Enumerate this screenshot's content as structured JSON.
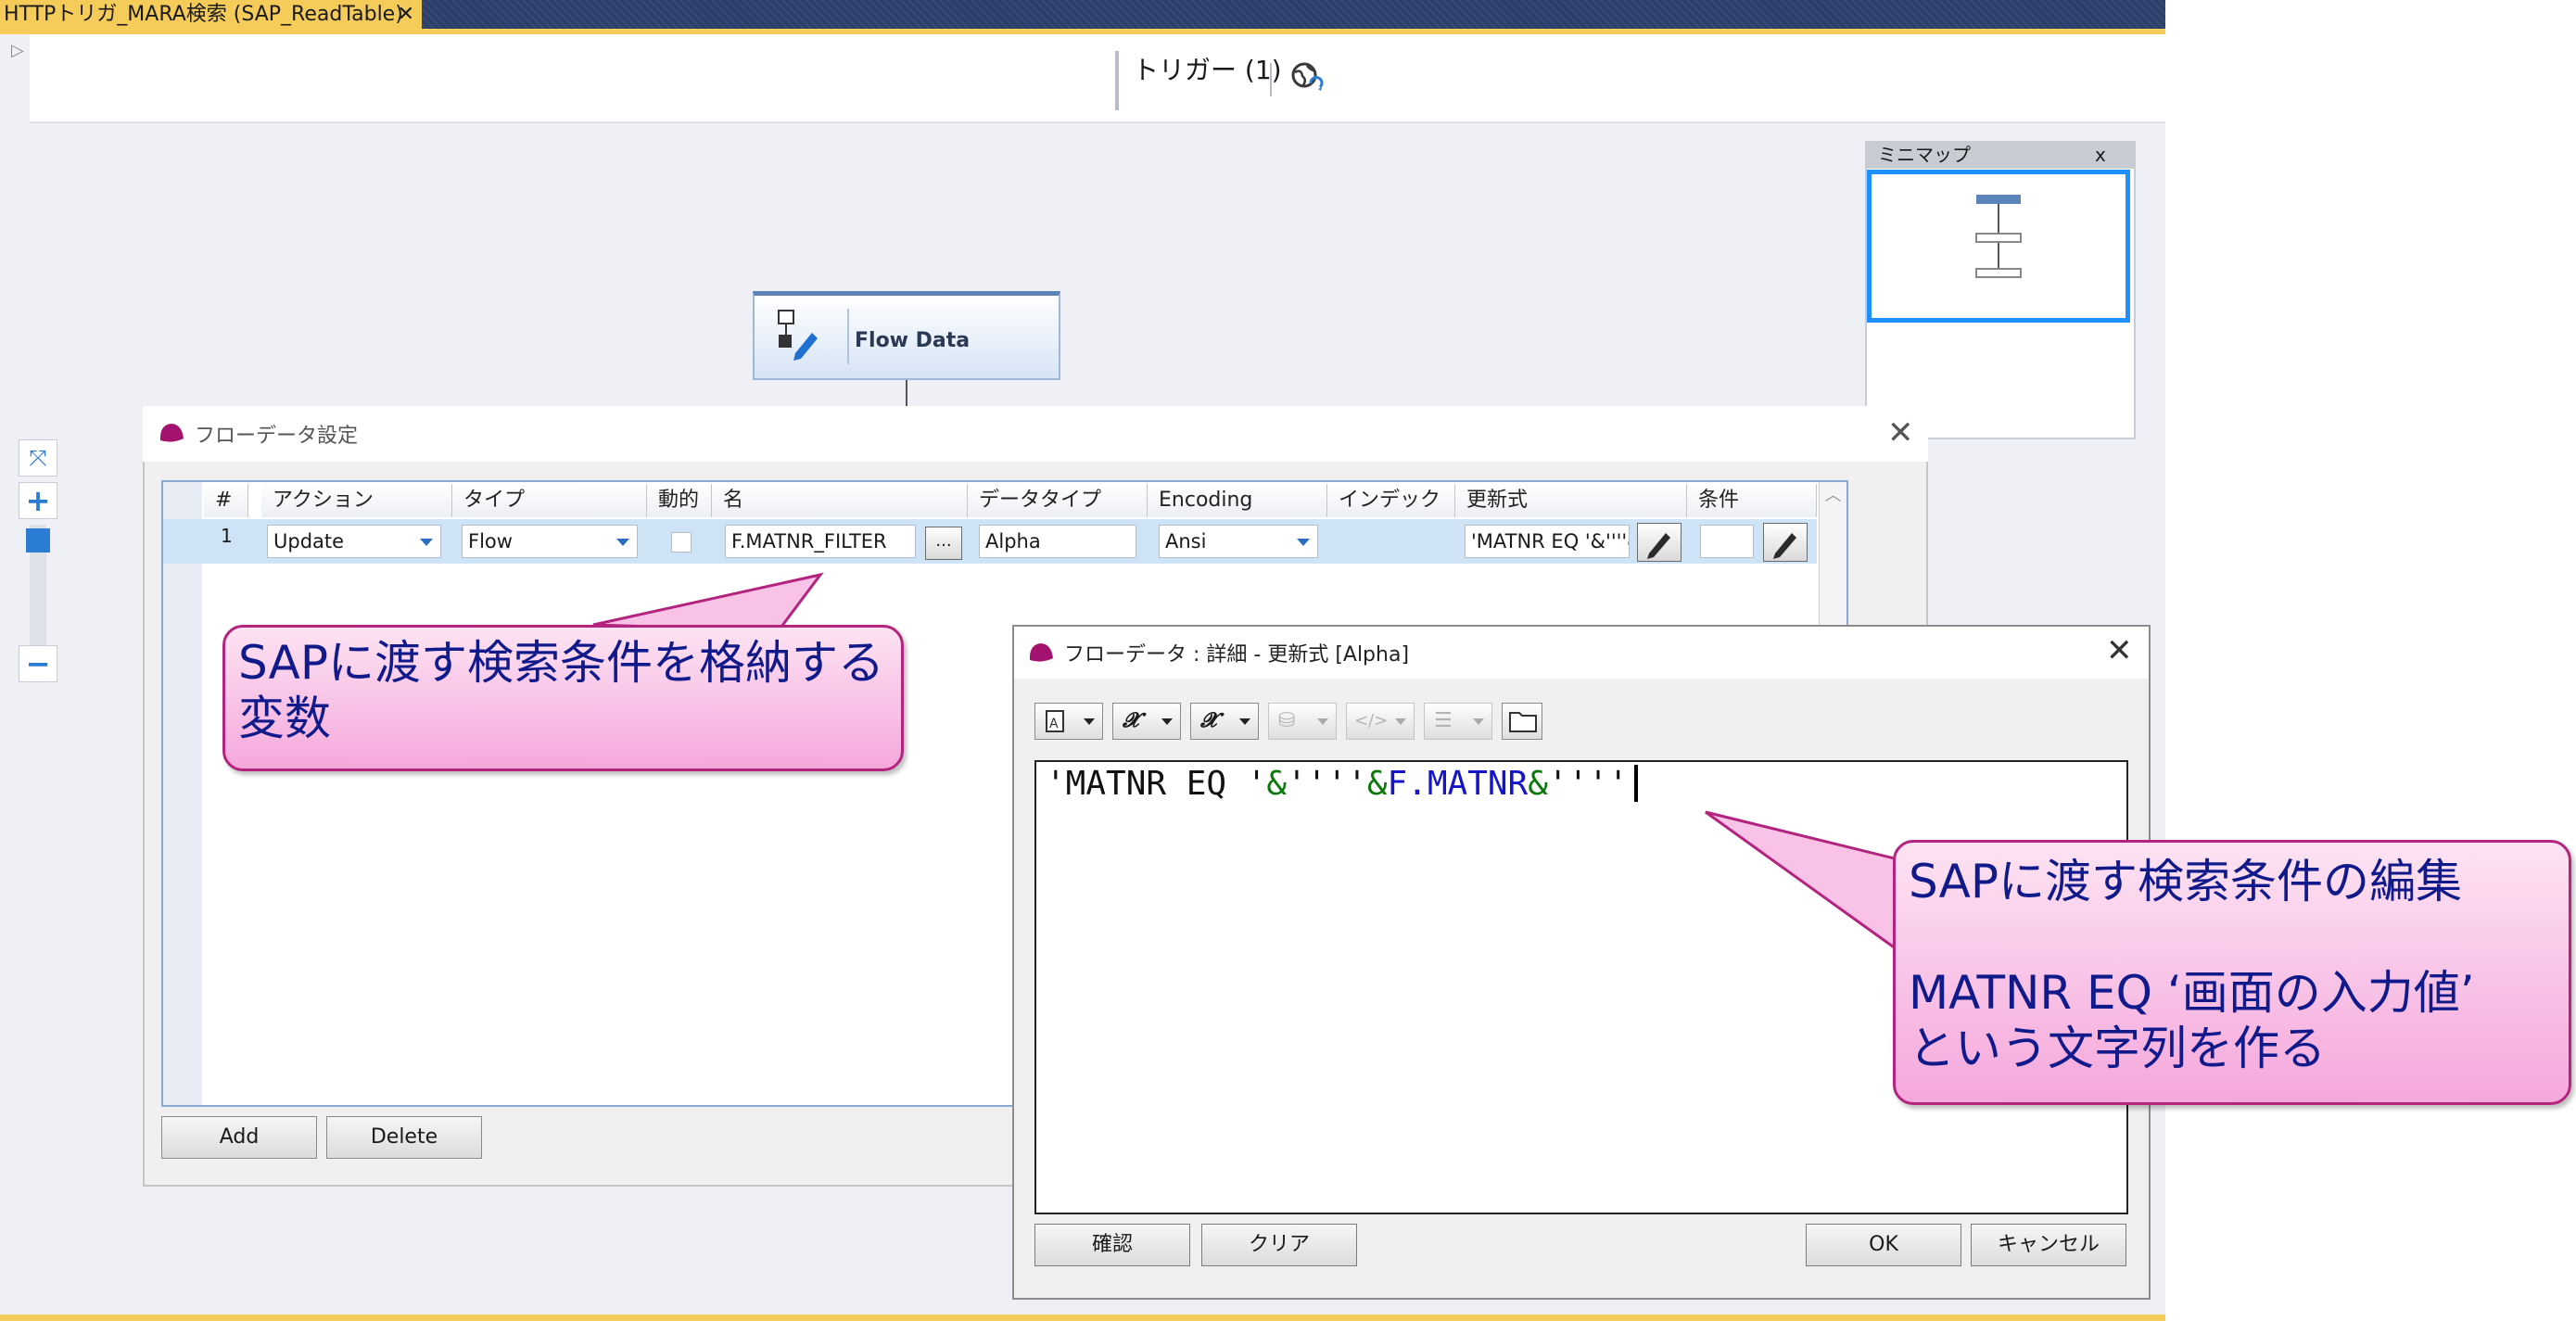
{
  "window": {
    "tab_title": "HTTPトリガ_MARA検索 (SAP_ReadTable)",
    "tab_close": "✕"
  },
  "toolbar": {
    "trigger_label": "トリガー (1)",
    "globe_icon": "globe-sync-icon"
  },
  "canvas": {
    "collapse_arrow": "▷",
    "flow_node_label": "Flow Data"
  },
  "zoom": {
    "fit": "⤧",
    "in": "+",
    "out": "−"
  },
  "minimap": {
    "title": "ミニマップ",
    "close": "x"
  },
  "settings_dialog": {
    "title": "フローデータ設定",
    "close": "✕",
    "columns": [
      "#",
      "アクション",
      "タイプ",
      "動的",
      "名",
      "データタイプ",
      "Encoding",
      "インデックス",
      "更新式",
      "条件"
    ],
    "rows": [
      {
        "num": "1",
        "action": "Update",
        "type": "Flow",
        "dynamic": false,
        "name": "F.MATNR_FILTER",
        "browse": "...",
        "data_type": "Alpha",
        "encoding": "Ansi",
        "index": "",
        "update_expr": "'MATNR EQ '&''''&",
        "condition": ""
      }
    ],
    "add_button": "Add",
    "delete_button": "Delete"
  },
  "detail_dialog": {
    "title": "フローデータ : 詳細 - 更新式 [Alpha]",
    "close": "✕",
    "expression": {
      "part1": "'MATNR EQ '",
      "part2": "&",
      "part3": "''''",
      "part4": "&",
      "part5": "F.MATNR",
      "part6": "&",
      "part7": "''''"
    },
    "buttons": {
      "confirm": "確認",
      "clear": "クリア",
      "ok": "OK",
      "cancel": "キャンセル"
    }
  },
  "callouts": {
    "variable_line1": "SAPに渡す検索条件を格納する",
    "variable_line2": "変数",
    "edit_line1": "SAPに渡す検索条件の編集",
    "edit_line2": "MATNR EQ ‘画面の入力値’",
    "edit_line3": "という文字列を作る"
  },
  "colors": {
    "tab_bar": "#2b3f6a",
    "active_tab": "#f5cc5a",
    "selection_row": "#cfe3f7",
    "callout_border": "#b3247f",
    "callout_text": "#111a8a"
  }
}
